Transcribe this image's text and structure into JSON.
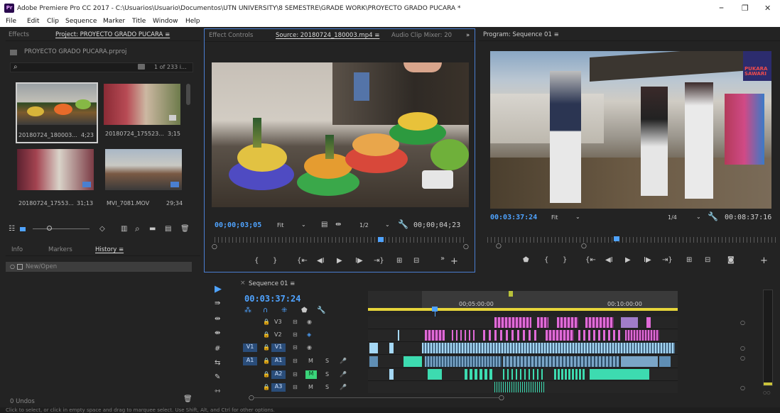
{
  "window": {
    "title": "Adobe Premiere Pro CC 2017 - C:\\Usuarios\\Usuario\\Documentos\\UTN UNIVERSITY\\8 SEMESTRE\\GRADE WORK\\PROYECTO GRADO PUCARA *",
    "logo": "Pr",
    "minimize": "–",
    "restore": "❐",
    "close": "✕"
  },
  "menu": [
    "File",
    "Edit",
    "Clip",
    "Sequence",
    "Marker",
    "Title",
    "Window",
    "Help"
  ],
  "project_panel": {
    "tabs": [
      "Effects",
      "Project: PROYECTO GRADO PUCARA ≡"
    ],
    "project_file": "PROYECTO GRADO PUCARA.prproj",
    "search_placeholder": "",
    "item_count": "1 of 233 i...",
    "clips": [
      {
        "name": "20180724_180003...",
        "duration": "4;23"
      },
      {
        "name": "20180724_175523...",
        "duration": "3;15"
      },
      {
        "name": "20180724_17553...",
        "duration": "31;13"
      },
      {
        "name": "MVI_7081.MOV",
        "duration": "29;34"
      }
    ]
  },
  "history_panel": {
    "tabs": [
      "Info",
      "Markers",
      "History ≡"
    ],
    "items": [
      "New/Open"
    ],
    "undo_count": "0 Undos"
  },
  "source_monitor": {
    "tabs": [
      "Effect Controls",
      "Source: 20180724_180003.mp4 ≡",
      "Audio Clip Mixer: 20"
    ],
    "overflow": "»",
    "timecode_in": "00;00;03;05",
    "fit": "Fit",
    "resolution": "1/2",
    "timecode_duration": "00;00;04;23"
  },
  "program_monitor": {
    "tab": "Program: Sequence 01 ≡",
    "timecode_in": "00:03:37:24",
    "fit": "Fit",
    "resolution": "1/4",
    "timecode_duration": "00:08:37:16",
    "watermark": "PUKARA SAWARI"
  },
  "timeline": {
    "tab": "Sequence 01 ≡",
    "close": "×",
    "timecode": "00:03:37:24",
    "ruler_labels": [
      "00;05:00:00",
      "00:10:00:00"
    ],
    "tracks": [
      {
        "src": "",
        "name": "V3",
        "type": "video"
      },
      {
        "src": "",
        "name": "V2",
        "type": "video"
      },
      {
        "src": "V1",
        "name": "V1",
        "type": "video"
      },
      {
        "src": "A1",
        "name": "A1",
        "type": "audio"
      },
      {
        "src": "",
        "name": "A2",
        "type": "audio"
      },
      {
        "src": "",
        "name": "A3",
        "type": "audio"
      }
    ],
    "audio_toggles": [
      "M",
      "S"
    ]
  },
  "status": "Click to select, or click in empty space and drag to marquee select. Use Shift, Alt, and Ctrl for other options.",
  "colors": {
    "accent": "#4fa3ff",
    "panel_bg": "#232323",
    "video_clip": "#a5d8f5",
    "pink_clip": "#e06ad7",
    "audio_clip": "#3ddbb0"
  }
}
